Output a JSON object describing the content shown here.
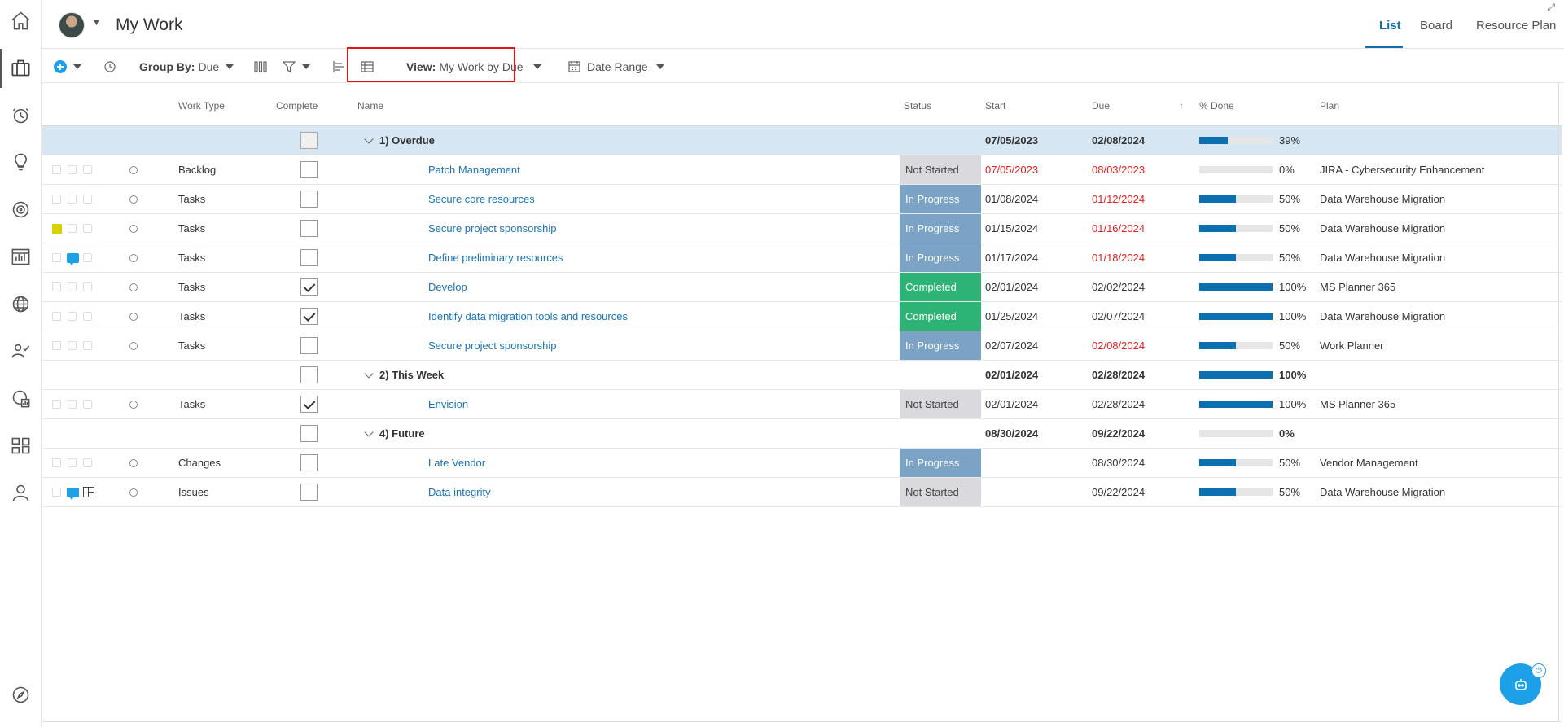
{
  "header": {
    "title": "My Work",
    "tabs": [
      {
        "label": "List",
        "active": true
      },
      {
        "label": "Board",
        "active": false
      },
      {
        "label": "Resource Plan",
        "active": false
      }
    ]
  },
  "toolbar": {
    "group_by_label": "Group By:",
    "group_by_value": "Due",
    "view_label": "View:",
    "view_value": "My Work by Due",
    "date_range_label": "Date Range"
  },
  "columns": {
    "work_type": "Work Type",
    "complete": "Complete",
    "name": "Name",
    "status": "Status",
    "start": "Start",
    "due": "Due",
    "pct_done": "% Done",
    "plan": "Plan"
  },
  "groups": [
    {
      "label": "1) Overdue",
      "start": "07/05/2023",
      "due": "02/08/2024",
      "pct": "39%",
      "progress": 0.39
    },
    {
      "label": "2) This Week",
      "start": "02/01/2024",
      "due": "02/28/2024",
      "pct": "100%",
      "progress": 1.0
    },
    {
      "label": "4) Future",
      "start": "08/30/2024",
      "due": "09/22/2024",
      "pct": "0%",
      "progress": 0.0
    }
  ],
  "rows": [
    {
      "work_type": "Backlog",
      "name": "Patch Management",
      "status": "Not Started",
      "start": "07/05/2023",
      "due": "08/03/2023",
      "pct": "0%",
      "progress": 0.0,
      "plan": "JIRA - Cybersecurity Enhancement",
      "complete": false
    },
    {
      "work_type": "Tasks",
      "name": "Secure core resources",
      "status": "In Progress",
      "start": "01/08/2024",
      "due": "01/12/2024",
      "pct": "50%",
      "progress": 0.5,
      "plan": "Data Warehouse Migration",
      "complete": false
    },
    {
      "work_type": "Tasks",
      "name": "Secure project sponsorship",
      "status": "In Progress",
      "start": "01/15/2024",
      "due": "01/16/2024",
      "pct": "50%",
      "progress": 0.5,
      "plan": "Data Warehouse Migration",
      "complete": false
    },
    {
      "work_type": "Tasks",
      "name": "Define preliminary resources",
      "status": "In Progress",
      "start": "01/17/2024",
      "due": "01/18/2024",
      "pct": "50%",
      "progress": 0.5,
      "plan": "Data Warehouse Migration",
      "complete": false
    },
    {
      "work_type": "Tasks",
      "name": "Develop",
      "status": "Completed",
      "start": "02/01/2024",
      "due": "02/02/2024",
      "pct": "100%",
      "progress": 1.0,
      "plan": "MS Planner 365",
      "complete": true
    },
    {
      "work_type": "Tasks",
      "name": "Identify data migration tools and resources",
      "status": "Completed",
      "start": "01/25/2024",
      "due": "02/07/2024",
      "pct": "100%",
      "progress": 1.0,
      "plan": "Data Warehouse Migration",
      "complete": true
    },
    {
      "work_type": "Tasks",
      "name": "Secure project sponsorship",
      "status": "In Progress",
      "start": "02/07/2024",
      "due": "02/08/2024",
      "pct": "50%",
      "progress": 0.5,
      "plan": "Work Planner",
      "complete": false
    },
    {
      "work_type": "Tasks",
      "name": "Envision",
      "status": "Not Started",
      "start": "02/01/2024",
      "due": "02/28/2024",
      "pct": "100%",
      "progress": 1.0,
      "plan": "MS Planner 365",
      "complete": true
    },
    {
      "work_type": "Changes",
      "name": "Late Vendor",
      "status": "In Progress",
      "start": "",
      "due": "08/30/2024",
      "pct": "50%",
      "progress": 0.5,
      "plan": "Vendor Management",
      "complete": false
    },
    {
      "work_type": "Issues",
      "name": "Data integrity",
      "status": "Not Started",
      "start": "",
      "due": "09/22/2024",
      "pct": "50%",
      "progress": 0.5,
      "plan": "Data Warehouse Migration",
      "complete": false
    }
  ],
  "colors": {
    "accent": "#0b6fb0",
    "status_not_started": "#d9d9de",
    "status_in_progress": "#7aa3c6",
    "status_completed": "#2db375",
    "overdue_text": "#e02020",
    "group_highlight": "#d6e6f3",
    "view_highlight_border": "#d9161c"
  }
}
